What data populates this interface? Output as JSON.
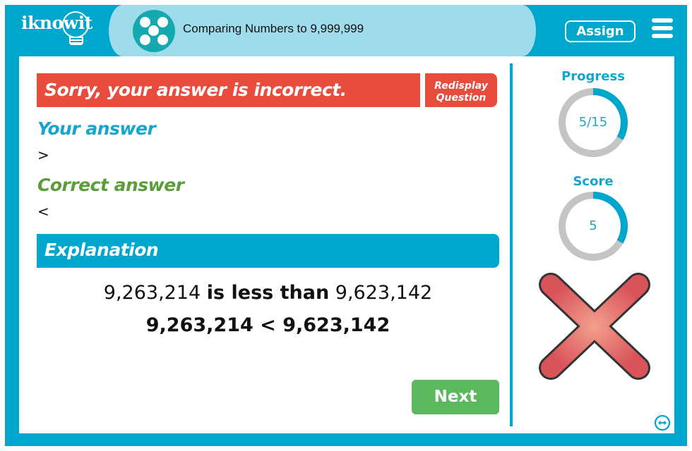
{
  "header": {
    "logo_text": "iknowit",
    "topic_title": "Comparing Numbers to 9,999,999",
    "topic_icon": "five-dots-icon",
    "assign_label": "Assign",
    "menu_icon": "hamburger-menu-icon"
  },
  "feedback": {
    "message": "Sorry, your answer is incorrect.",
    "redisplay_line1": "Redisplay",
    "redisplay_line2": "Question",
    "your_answer_label": "Your answer",
    "your_answer_value": ">",
    "correct_answer_label": "Correct answer",
    "correct_answer_value": "<"
  },
  "explanation": {
    "title": "Explanation",
    "number_a": "9,263,214",
    "relation_text": "is less than",
    "number_b": "9,623,142",
    "equation": "9,263,214 < 9,623,142"
  },
  "next_label": "Next",
  "stats": {
    "progress_label": "Progress",
    "progress_text": "5/15",
    "progress_fraction": 0.3333,
    "score_label": "Score",
    "score_text": "5",
    "score_fraction": 0.3333
  },
  "status_icon": "red-x-incorrect-icon",
  "colors": {
    "brand_blue": "#00a7cd",
    "header_light": "#9edcec",
    "error_red": "#e84c3d",
    "correct_green": "#5b9d3a",
    "next_green": "#5cb85c",
    "ring_gray": "#c4c4c4"
  }
}
